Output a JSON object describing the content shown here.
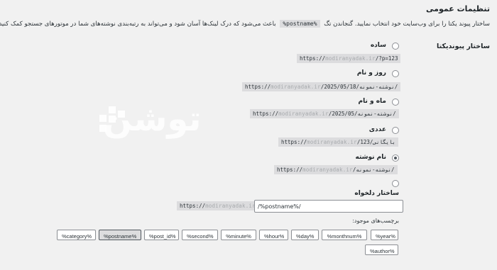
{
  "section_title": "تنظیمات عمومی",
  "description_before": "ساختار پیوند یکتا را برای وب‌سایت خود انتخاب نمایید. گنجاندن تگ",
  "description_tag": "%postname%",
  "description_after": "باعث می‌شود که درک لینک‌ها آسان شود و می‌تواند به رتبه‌بندی نوشته‌های شما در موتورهای جستجو کمک کنید.",
  "row_label": "ساختار پیوندیکتا",
  "options": [
    {
      "label": "ساده",
      "sample_host": "https://",
      "sample_blur": "modiranyadak.ir",
      "sample_path": "/?p=123",
      "checked": false
    },
    {
      "label": "روز و نام",
      "sample_host": "https://",
      "sample_blur": "modiranyadak.ir",
      "sample_path": "/2025/05/18/نوشته-نمونه/",
      "checked": false
    },
    {
      "label": "ماه و نام",
      "sample_host": "https://",
      "sample_blur": "modiranyadak.ir",
      "sample_path": "/2025/05/نوشته-نمونه/",
      "checked": false
    },
    {
      "label": "عددی",
      "sample_host": "https://",
      "sample_blur": "modiranyadak.ir",
      "sample_path": "/بایگانی/123",
      "checked": false
    },
    {
      "label": "نام نوشته",
      "sample_host": "https://",
      "sample_blur": "modiranyadak.ir",
      "sample_path": "/نوشته-نمونه/",
      "checked": true
    }
  ],
  "custom": {
    "label": "ساختار دلخواه",
    "prefix_host": "https://",
    "prefix_blur": "modiranyadak.ir",
    "value": "/%postname%/"
  },
  "tags_label": "برچسب‌های موجود:",
  "tags": [
    "%year%",
    "%monthnum%",
    "%day%",
    "%hour%",
    "%minute%",
    "%second%",
    "%post_id%",
    "%postname%",
    "%category%",
    "%author%"
  ],
  "active_tag": "%postname%",
  "watermark": "توشن"
}
